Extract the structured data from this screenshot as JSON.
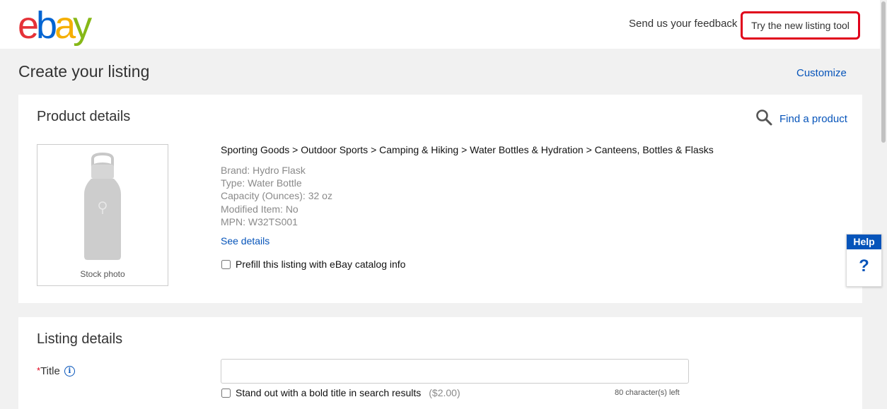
{
  "header": {
    "logo_letters": [
      "e",
      "b",
      "a",
      "y"
    ],
    "logo_colors": [
      "#e53238",
      "#0064d2",
      "#f5af02",
      "#86b817"
    ],
    "feedback_link": "Send us your feedback",
    "try_new_button": "Try the new listing tool",
    "highlight_color": "#e0001b"
  },
  "page": {
    "title": "Create your listing",
    "customize_link": "Customize"
  },
  "product_details": {
    "heading": "Product details",
    "find_product_label": "Find a product",
    "find_product_icon": "search-icon",
    "photo_caption": "Stock photo",
    "breadcrumb": "Sporting Goods > Outdoor Sports > Camping & Hiking > Water Bottles & Hydration > Canteens, Bottles & Flasks",
    "specs": [
      "Brand: Hydro Flask",
      "Type: Water Bottle",
      "Capacity (Ounces): 32 oz",
      "Modified Item: No",
      "MPN: W32TS001"
    ],
    "see_details_link": "See details",
    "prefill_label": "Prefill this listing with eBay catalog info",
    "prefill_checked": false
  },
  "listing_details": {
    "heading": "Listing details",
    "title_label": "Title",
    "title_required_mark": "*",
    "title_value": "",
    "bold_title_label": "Stand out with a bold title in search results",
    "bold_title_price": "($2.00)",
    "bold_title_checked": false,
    "chars_left": "80 character(s) left"
  },
  "help_widget": {
    "label": "Help",
    "icon_glyph": "?"
  },
  "colors": {
    "link": "#0654ba",
    "background": "#f1f1f1"
  }
}
